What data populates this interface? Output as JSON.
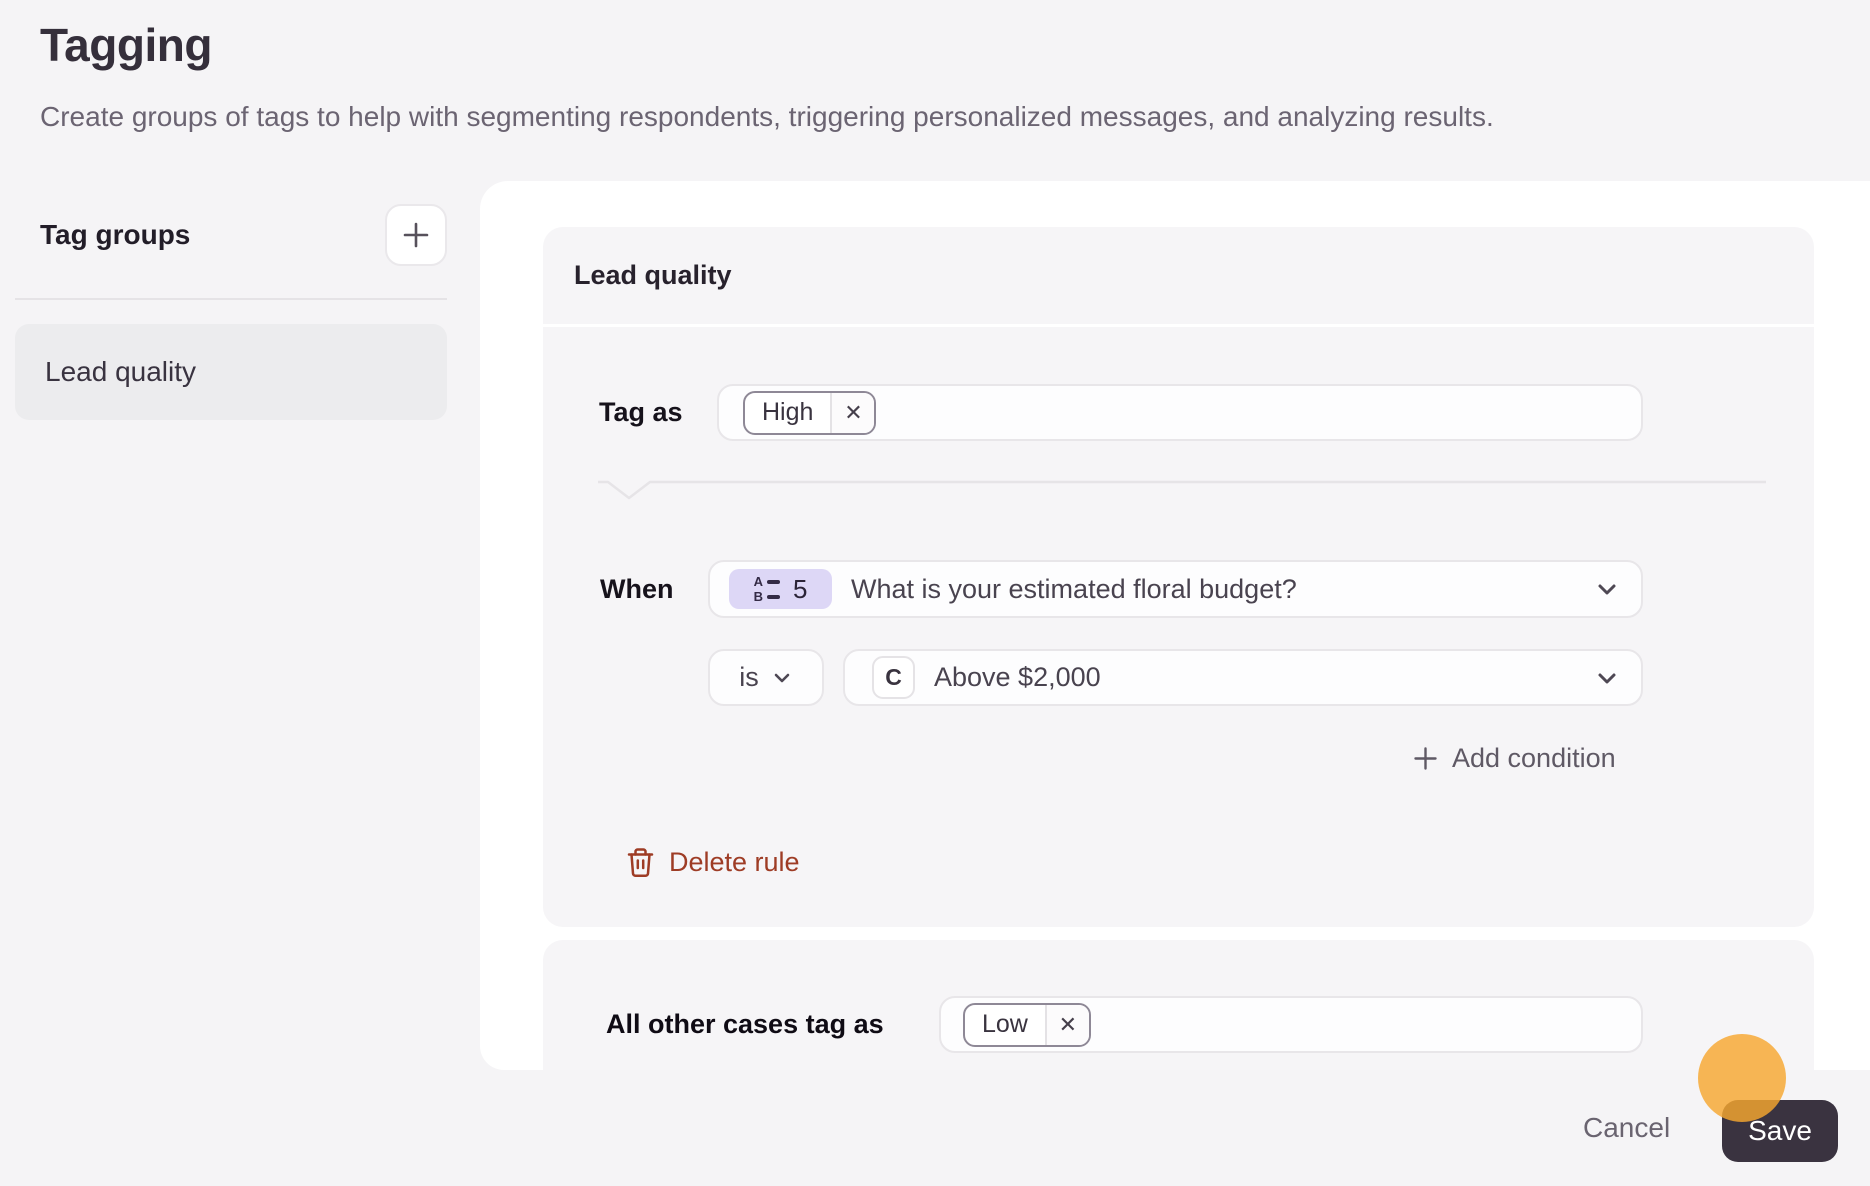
{
  "header": {
    "title": "Tagging",
    "description": "Create groups of tags to help with segmenting respondents, triggering personalized messages, and analyzing results."
  },
  "sidebar": {
    "heading": "Tag groups",
    "items": [
      {
        "label": "Lead quality",
        "selected": true
      }
    ]
  },
  "panel": {
    "group_title": "Lead quality",
    "rule": {
      "tag_as_label": "Tag as",
      "tags": [
        {
          "label": "High"
        }
      ],
      "when_label": "When",
      "question": {
        "number": "5",
        "text": "What is your estimated floral budget?",
        "type": "multiple-choice"
      },
      "operator": "is",
      "value": {
        "badge": "C",
        "text": "Above $2,000"
      },
      "add_condition_label": "Add condition",
      "delete_rule_label": "Delete rule"
    },
    "fallback": {
      "label": "All other cases tag as",
      "tags": [
        {
          "label": "Low"
        }
      ]
    }
  },
  "footer": {
    "cancel_label": "Cancel",
    "save_label": "Save"
  },
  "icons": {
    "remove_glyph": "✕",
    "add_group": "plus-icon",
    "question_type": "multiple-choice-icon",
    "expand": "chevron-down-icon",
    "add_condition": "plus-icon",
    "delete_rule": "trash-icon"
  },
  "colors": {
    "page_bg": "#f5f4f6",
    "panel_bg": "#ffffff",
    "card_bg": "#f6f5f7",
    "sidebar_selected_bg": "#ececee",
    "question_badge_bg": "#ddd7f6",
    "delete_accent": "#9e3c25",
    "save_button_bg": "#3a3340",
    "cursor_highlight": "#f6a730"
  }
}
